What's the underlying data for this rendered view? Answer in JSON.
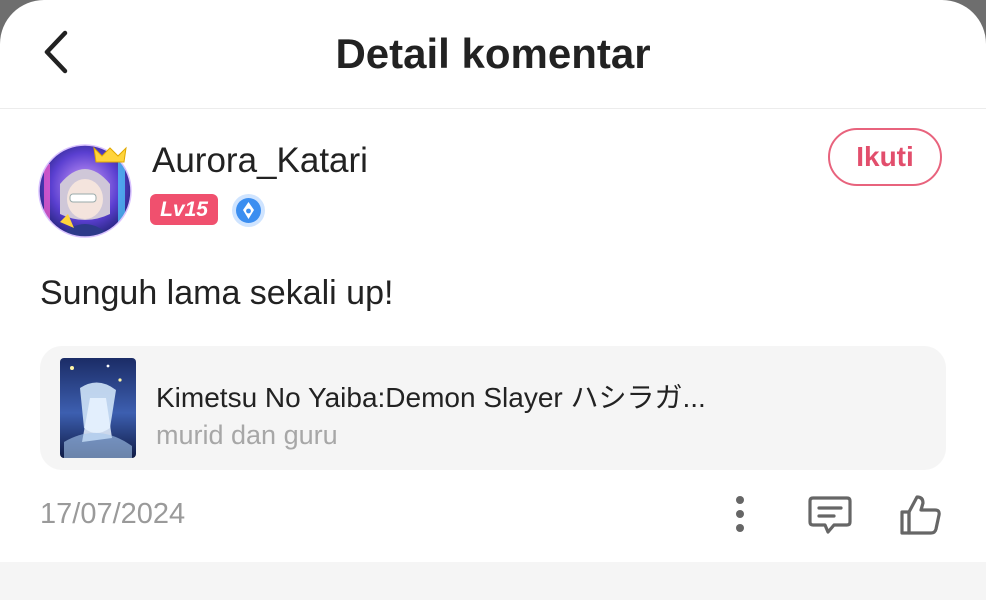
{
  "header": {
    "title": "Detail komentar"
  },
  "comment": {
    "username": "Aurora_Katari",
    "level": "Lv15",
    "follow_label": "Ikuti",
    "text": "Sunguh lama sekali up!",
    "date": "17/07/2024"
  },
  "work": {
    "title": "Kimetsu No Yaiba:Demon Slayer ハシラガ...",
    "subtitle": "murid dan guru"
  },
  "icons": {
    "back": "chevron-left-icon",
    "verified": "verified-badge-icon",
    "more": "more-vertical-icon",
    "reply": "comment-icon",
    "like": "thumbs-up-icon"
  },
  "colors": {
    "accent": "#e24e6c",
    "level_badge": "#f0506e",
    "verified": "#3b8ef0",
    "muted_text": "#9a9a9a",
    "card_bg": "#f5f5f5"
  }
}
